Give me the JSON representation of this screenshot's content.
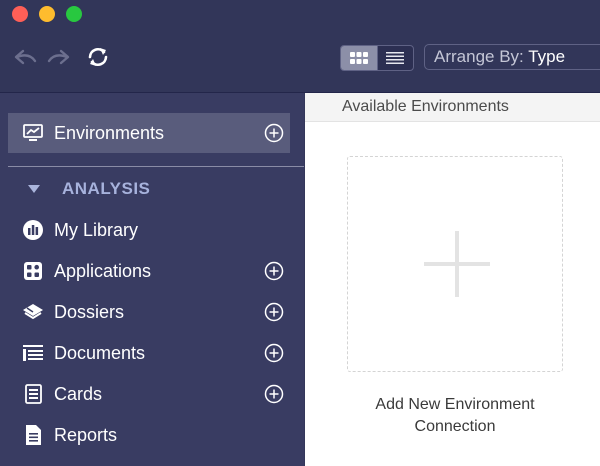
{
  "toolbar": {
    "arrange_prefix": "Arrange By: ",
    "arrange_value": "Type"
  },
  "sidebar": {
    "environments": {
      "label": "Environments",
      "icon": "monitor-chart-icon"
    },
    "section": {
      "label": "ANALYSIS"
    },
    "items": [
      {
        "label": "My Library",
        "icon": "library-icon",
        "has_add": false
      },
      {
        "label": "Applications",
        "icon": "applications-icon",
        "has_add": true
      },
      {
        "label": "Dossiers",
        "icon": "dossier-icon",
        "has_add": true
      },
      {
        "label": "Documents",
        "icon": "document-list-icon",
        "has_add": true
      },
      {
        "label": "Cards",
        "icon": "cards-icon",
        "has_add": true
      },
      {
        "label": "Reports",
        "icon": "report-icon",
        "has_add": false
      }
    ]
  },
  "content": {
    "header": "Available Environments",
    "add_caption_line1": "Add New Environment",
    "add_caption_line2": "Connection"
  },
  "colors": {
    "sidebar_bg": "#393c62",
    "selected_row": "#595c7c",
    "section_header": "#a7b2dc",
    "close": "#fe5f57",
    "minimize": "#febc2e",
    "maximize": "#28c840"
  }
}
